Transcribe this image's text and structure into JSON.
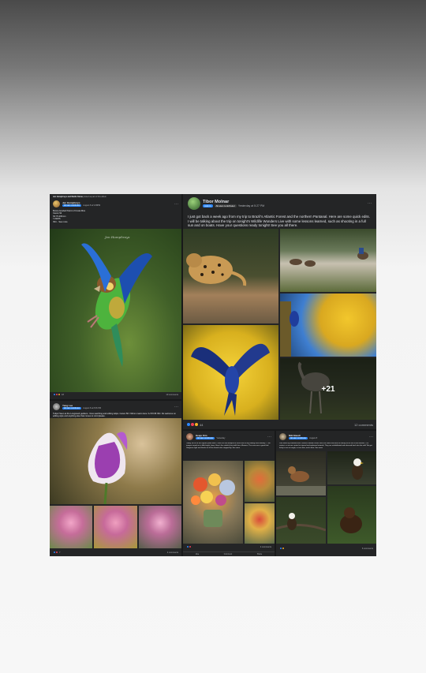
{
  "posts": {
    "parrot": {
      "shared_line": "Jen Humphreys and Marlin Stone",
      "shared_suffix": "posted as part of this album",
      "author": "Jen Humphreys",
      "badge": "All-star contributor",
      "meta": "August 8 at 9:38PM",
      "body_lines": [
        "Brown-hooded Parrot of Costa Rica",
        "Canon 5d",
        "SF 70-200mm",
        "f 1/320S",
        "ISO... See more"
      ],
      "watermark": "Jen Humphreys",
      "reaction_count": "18",
      "comments": "10 comments"
    },
    "brazil": {
      "author": "Tibor Molnar",
      "badge": "Admin",
      "badge2": "All-star contributor",
      "meta": "Yesterday at 5:27 PM",
      "body": "I just got back a week ago from my trip to Brazil's Atlantic Forest and the northern Pantanal. Here are some quick edits. I will be talking about the trip on tonight's Wildlife Wonders Live with some lessons learned, such as shooting in a full sun and on boats. Have your questions ready tonight! See you all there.",
      "more_photos": "+21",
      "reaction_count": "44",
      "comments": "12 comments"
    },
    "tulip": {
      "author": "Yang Lee",
      "badge": "All-star contributor",
      "meta": "August 8 at 8:06 PM",
      "body": "Tulips! Seen at the Longwood gardens. I love watching and editing tulips. Canon 5D / 90mm macro lens / 1/170 f/8 ISO. Do welcome on editing style and anything else that comes to mind please.",
      "reaction_count": "7",
      "comments": "4 comments"
    },
    "bouquet": {
      "author": "Heeje Kim",
      "badge": "All-star contributor",
      "meta": "Yesterday",
      "body": "Today, we're on our regular photo walk. Check out our bouquet of roses with all my editing from Monday — the images turned out a little bright, hmm. Here's the colorful shot with lots of flowers. The vase was a great find. Gorgeous light and thanks to all the friends who stopped by. See more",
      "reaction_count": "",
      "comments": "4 comments",
      "actions": [
        "Like",
        "Comment",
        "Share"
      ]
    },
    "wildlife": {
      "author": "Niki Baudi",
      "badge": "All-star contributor",
      "meta": "August 8",
      "body": "Last week my husband and I visited a wildlife center near our cabin and took the family out to see a few animals. The center is a rescue center for injured and orphaned animals. They are rehabilitated and released back into the wild. We got lucky to see an eagle, a river otter, and a bear. See more",
      "comments": "6 comments"
    }
  },
  "colors": {
    "panel": "#242526",
    "text": "#e4e6eb",
    "muted": "#b0b3b8",
    "accent": "#2d88ff"
  }
}
